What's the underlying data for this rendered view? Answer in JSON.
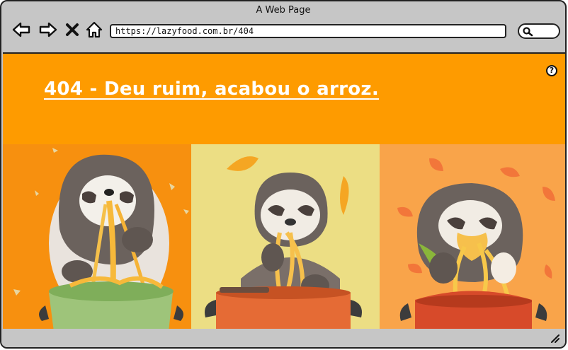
{
  "window": {
    "title": "A Web Page"
  },
  "toolbar": {
    "url": "https://lazyfood.com.br/404",
    "back_icon": "back-arrow-icon",
    "forward_icon": "forward-arrow-icon",
    "stop_icon": "close-icon",
    "home_icon": "home-icon",
    "search_icon": "search-icon"
  },
  "page": {
    "heading": "404 - Deu ruim, acabou o arroz.",
    "help_label": "?",
    "background_color": "#fe9b00",
    "images": [
      {
        "subject": "sloth-eating-noodles-green-pot",
        "background": "#f7900f"
      },
      {
        "subject": "sloth-eating-noodles-orange-pot",
        "background": "#ecde84"
      },
      {
        "subject": "sloth-eating-pasta-red-pot",
        "background": "#f9a44a"
      }
    ]
  }
}
